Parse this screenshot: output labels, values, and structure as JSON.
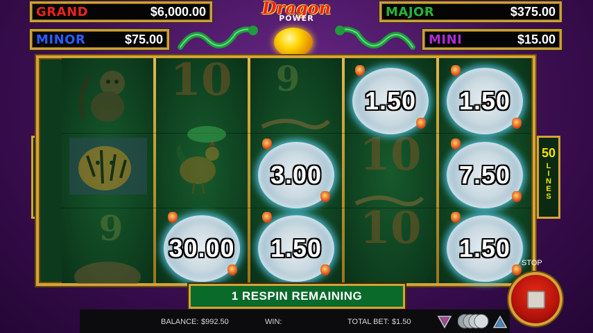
{
  "jackpots": {
    "grand": {
      "name": "GRAND",
      "value": "$6,000.00",
      "color": "#e8241a"
    },
    "major": {
      "name": "MAJOR",
      "value": "$375.00",
      "color": "#25b43a"
    },
    "minor": {
      "name": "MINOR",
      "value": "$75.00",
      "color": "#2a5cff"
    },
    "mini": {
      "name": "MINI",
      "value": "$15.00",
      "color": "#b02bd6"
    }
  },
  "logo": {
    "title": "Dragon",
    "subtitle": "POWER"
  },
  "lines_badge": {
    "count": "50",
    "word": "LINES"
  },
  "reels": {
    "orbs": [
      {
        "reel": 3,
        "row": 0,
        "value": "1.50"
      },
      {
        "reel": 4,
        "row": 0,
        "value": "1.50"
      },
      {
        "reel": 2,
        "row": 1,
        "value": "3.00"
      },
      {
        "reel": 4,
        "row": 1,
        "value": "7.50"
      },
      {
        "reel": 1,
        "row": 2,
        "value": "30.00"
      },
      {
        "reel": 2,
        "row": 2,
        "value": "1.50"
      },
      {
        "reel": 4,
        "row": 2,
        "value": "1.50"
      }
    ],
    "symbols": [
      {
        "reel": 0,
        "row": 0,
        "symbol": "monkey-icon"
      },
      {
        "reel": 0,
        "row": 1,
        "symbol": "tiger-icon"
      },
      {
        "reel": 0,
        "row": 2,
        "symbol": "9"
      },
      {
        "reel": 1,
        "row": 0,
        "symbol": "10"
      },
      {
        "reel": 1,
        "row": 1,
        "symbol": "rooster-icon"
      },
      {
        "reel": 2,
        "row": 0,
        "symbol": "9"
      },
      {
        "reel": 3,
        "row": 1,
        "symbol": "10"
      },
      {
        "reel": 3,
        "row": 2,
        "symbol": "10"
      }
    ]
  },
  "respin_banner": "1 RESPIN REMAINING",
  "footer": {
    "balance_label": "BALANCE:",
    "balance_value": "$992.50",
    "win_label": "WIN:",
    "win_value": "",
    "total_bet_label": "TOTAL BET:",
    "total_bet_value": "$1.50"
  },
  "stop_label": "STOP"
}
